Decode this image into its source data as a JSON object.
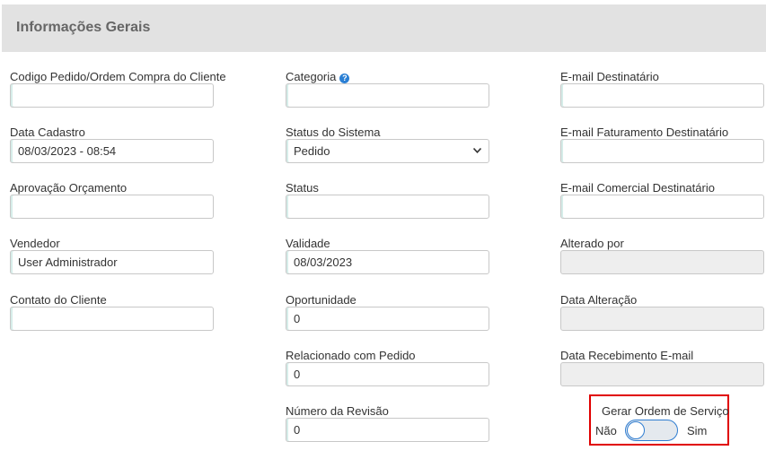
{
  "section": {
    "title": "Informações Gerais"
  },
  "col1": {
    "codigo_pedido": {
      "label": "Codigo Pedido/Ordem Compra do Cliente",
      "value": ""
    },
    "data_cadastro": {
      "label": "Data Cadastro",
      "value": "08/03/2023 - 08:54"
    },
    "aprovacao_orcamento": {
      "label": "Aprovação Orçamento",
      "value": ""
    },
    "vendedor": {
      "label": "Vendedor",
      "value": "User Administrador"
    },
    "contato_cliente": {
      "label": "Contato do Cliente",
      "value": ""
    }
  },
  "col2": {
    "categoria": {
      "label": "Categoria",
      "help_icon": "question-circle-icon",
      "value": ""
    },
    "status_sistema": {
      "label": "Status do Sistema",
      "value": "Pedido"
    },
    "status": {
      "label": "Status",
      "value": ""
    },
    "validade": {
      "label": "Validade",
      "value": "08/03/2023"
    },
    "oportunidade": {
      "label": "Oportunidade",
      "value": "0"
    },
    "relacionado_pedido": {
      "label": "Relacionado com Pedido",
      "value": "0"
    },
    "numero_revisao": {
      "label": "Número da Revisão",
      "value": "0"
    }
  },
  "col3": {
    "email_destinatario": {
      "label": "E-mail Destinatário",
      "value": ""
    },
    "email_faturamento": {
      "label": "E-mail Faturamento Destinatário",
      "value": ""
    },
    "email_comercial": {
      "label": "E-mail Comercial Destinatário",
      "value": ""
    },
    "alterado_por": {
      "label": "Alterado por",
      "value": ""
    },
    "data_alteracao": {
      "label": "Data Alteração",
      "value": ""
    },
    "data_recebimento_email": {
      "label": "Data Recebimento E-mail",
      "value": ""
    }
  },
  "gerar_os": {
    "label": "Gerar Ordem de Serviço",
    "off_label": "Não",
    "on_label": "Sim",
    "state": "Não"
  },
  "colors": {
    "header_bg": "#e2e2e2",
    "toggle_border": "#2f7dd1",
    "highlight_border": "#e00000",
    "disabled_bg": "#eeeeee"
  }
}
